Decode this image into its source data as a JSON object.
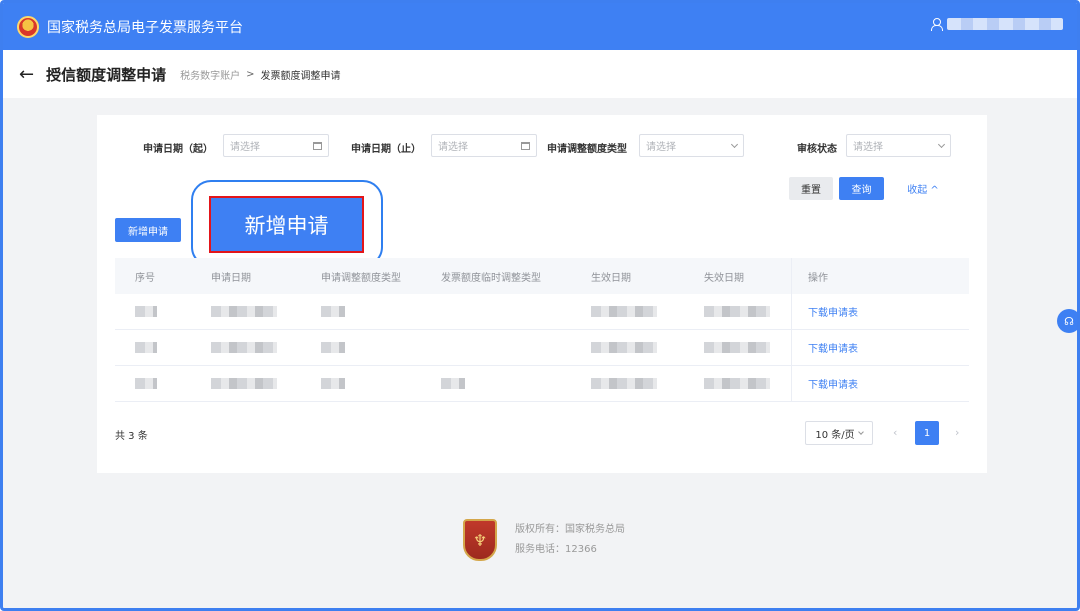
{
  "header": {
    "app_title": "国家税务总局电子发票服务平台"
  },
  "subheader": {
    "page_title": "授信额度调整申请",
    "breadcrumb": [
      "税务数字账户",
      "发票额度调整申请"
    ],
    "breadcrumb_sep": ">"
  },
  "filters": {
    "start_date": {
      "label": "申请日期（起）",
      "placeholder": "请选择"
    },
    "end_date": {
      "label": "申请日期（止）",
      "placeholder": "请选择"
    },
    "adjust_type": {
      "label": "申请调整额度类型",
      "placeholder": "请选择"
    },
    "review_status": {
      "label": "审核状态",
      "placeholder": "请选择"
    }
  },
  "actions": {
    "reset": "重置",
    "query": "查询",
    "collapse": "收起 ^",
    "add": "新增申请",
    "callout": "新增申请"
  },
  "table": {
    "columns": [
      "序号",
      "申请日期",
      "申请调整额度类型",
      "发票额度临时调整类型",
      "生效日期",
      "失效日期",
      "操作"
    ],
    "rows": [
      {
        "action": "下载申请表"
      },
      {
        "action": "下载申请表"
      },
      {
        "action": "下载申请表"
      }
    ]
  },
  "pagination": {
    "total": "共 3 条",
    "page_size": "10 条/页",
    "current_page": "1"
  },
  "footer": {
    "copyright": "版权所有：国家税务总局",
    "phone": "服务电话：12366"
  },
  "colors": {
    "primary": "#3e80f3",
    "highlight": "#e3151a"
  },
  "icons": [
    "back-arrow-icon",
    "user-icon",
    "calendar-icon",
    "chevron-down-icon",
    "help-icon"
  ]
}
